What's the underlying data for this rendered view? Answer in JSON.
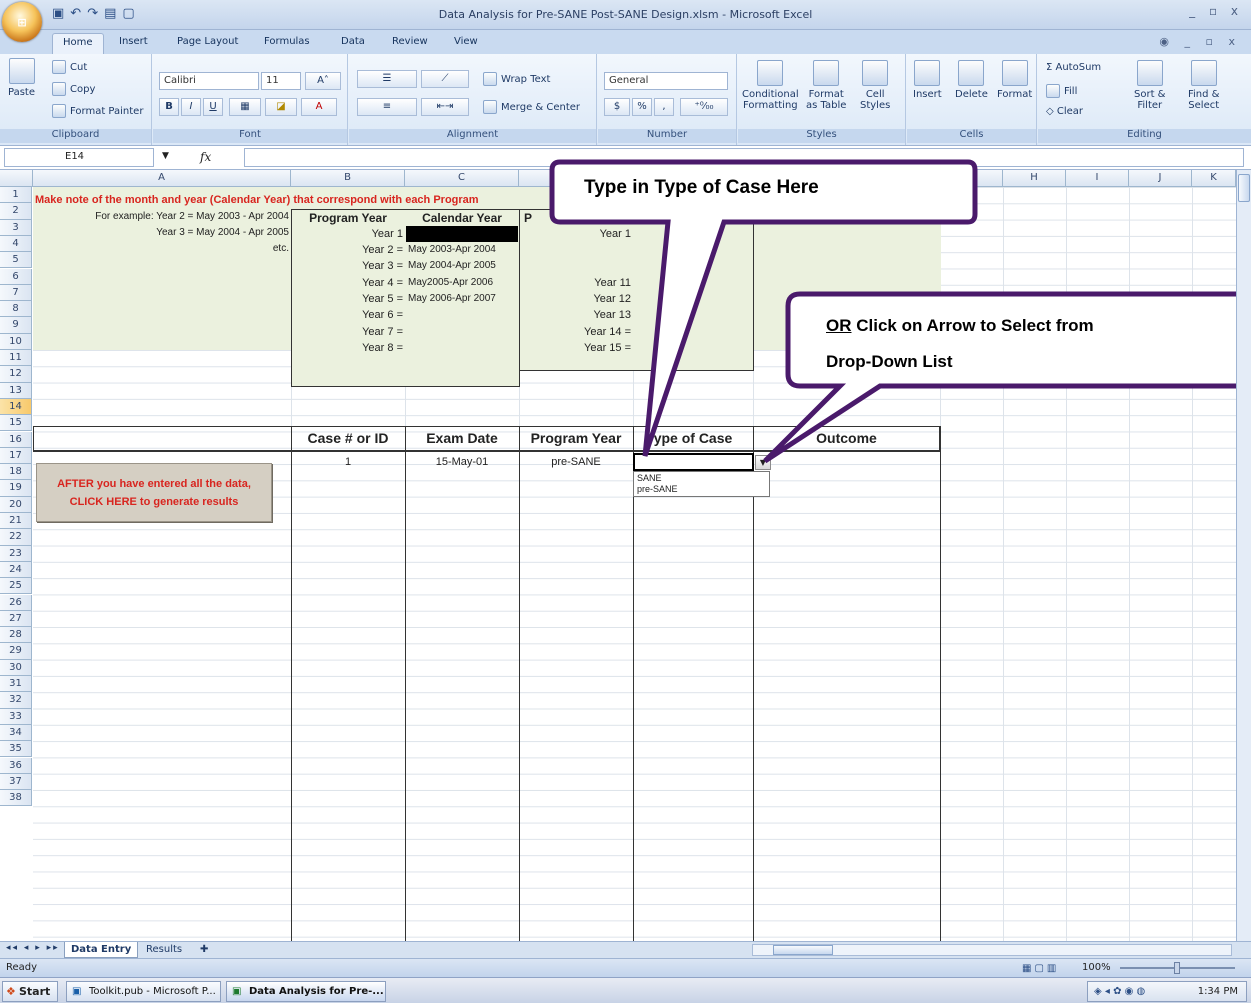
{
  "window": {
    "title": "Data Analysis for Pre-SANE Post-SANE Design.xlsm - Microsoft Excel",
    "controls": "_ ▫ x",
    "office_button": "Office"
  },
  "quick_access": [
    "save-icon",
    "undo-icon",
    "redo-icon",
    "open-icon",
    "print-preview-icon"
  ],
  "ribbon_tabs": [
    "Home",
    "Insert",
    "Page Layout",
    "Formulas",
    "Data",
    "Review",
    "View"
  ],
  "ribbon": {
    "clipboard": {
      "label": "Clipboard",
      "paste": "Paste",
      "cut": "Cut",
      "copy": "Copy",
      "format_painter": "Format Painter"
    },
    "font": {
      "label": "Font",
      "name": "Calibri",
      "size": "11",
      "bold": "B",
      "italic": "I",
      "underline": "U",
      "grow": "A˄",
      "shrink": "A˅"
    },
    "alignment": {
      "label": "Alignment",
      "wrap": "Wrap Text",
      "merge": "Merge & Center"
    },
    "number": {
      "label": "Number",
      "format": "General",
      "currency": "$",
      "percent": "%",
      "comma": ","
    },
    "styles": {
      "label": "Styles",
      "conditional_1": "Conditional",
      "conditional_2": "Formatting",
      "format_table_1": "Format",
      "format_table_2": "as Table",
      "cell_styles_1": "Cell",
      "cell_styles_2": "Styles"
    },
    "cells": {
      "label": "Cells",
      "insert": "Insert",
      "delete": "Delete",
      "format": "Format"
    },
    "editing": {
      "label": "Editing",
      "autosum": "AutoSum",
      "fill": "Fill",
      "clear": "Clear",
      "sort_1": "Sort &",
      "sort_2": "Filter",
      "find_1": "Find &",
      "find_2": "Select"
    }
  },
  "formula_bar": {
    "name_box": "E14",
    "fx": "fx",
    "formula": ""
  },
  "columns": [
    "A",
    "B",
    "C",
    "D",
    "E",
    "F",
    "G",
    "H",
    "I",
    "J",
    "K"
  ],
  "rows": [
    "1",
    "2",
    "3",
    "4",
    "5",
    "6",
    "7",
    "8",
    "9",
    "10",
    "11",
    "12",
    "13",
    "14",
    "15",
    "16",
    "17",
    "18",
    "19",
    "20",
    "21",
    "22",
    "23",
    "24",
    "25",
    "26",
    "27",
    "28",
    "29",
    "30",
    "31",
    "32",
    "33",
    "34",
    "35",
    "36",
    "37",
    "38"
  ],
  "sheet": {
    "note": "Make note of the month and year (Calendar Year) that correspond with each Program",
    "example_1": "For example:  Year 2 = May 2003 - Apr 2004",
    "example_2": "Year 3 = May 2004 - Apr 2005",
    "example_3": "etc.",
    "program_year_header": "Program Year",
    "calendar_year_header": "Calendar Year",
    "program_year_header_2": "P",
    "years_b": [
      "Year 1",
      "Year 2 =",
      "Year 3 =",
      "Year 4 =",
      "Year 5 =",
      "Year 6 =",
      "Year 7 =",
      "Year 8 ="
    ],
    "calendars_c": [
      "",
      "May 2003-Apr 2004",
      "May 2004-Apr 2005",
      "May2005-Apr 2006",
      "May 2006-Apr 2007",
      "",
      "",
      ""
    ],
    "years_d": [
      "Year 1",
      "Year 11",
      "Year 12",
      "Year 13",
      "Year 14 =",
      "Year 15 ="
    ],
    "headers_13": [
      "Case # or ID",
      "Exam Date",
      "Program Year",
      "ype of Case",
      "Outcome"
    ],
    "row14": {
      "case": "1",
      "date": "15-May-01",
      "program_year": "pre-SANE"
    }
  },
  "dropdown_options": [
    "SANE",
    "pre-SANE"
  ],
  "macro_button": {
    "line1": "AFTER you have entered all the data,",
    "line2": "CLICK HERE to generate results"
  },
  "callouts": {
    "type_here": "Type in Type of Case Here",
    "or_word": "OR",
    "select_rest": " Click on Arrow to Select from",
    "select_line2": "Drop-Down List"
  },
  "sheet_tabs": [
    "Data Entry",
    "Results"
  ],
  "status": {
    "ready": "Ready",
    "zoom": "100%"
  },
  "taskbar": {
    "start": "Start",
    "items": [
      "Toolkit.pub - Microsoft P...",
      "Data Analysis for Pre-..."
    ],
    "clock": "1:34 PM"
  },
  "colors": {
    "note_red": "#d8251f",
    "callout_purple": "#4a1a6b",
    "green_fill": "#ebf1de",
    "selected_header": "#f8c96b"
  }
}
